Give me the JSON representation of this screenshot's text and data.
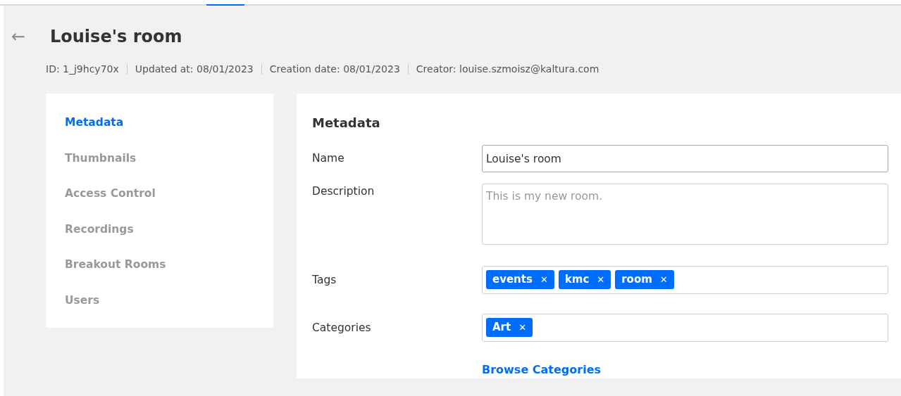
{
  "back_icon": "←",
  "title": "Louise's room",
  "meta": [
    "ID: 1_j9hcy70x",
    "Updated at: 08/01/2023",
    "Creation date: 08/01/2023",
    "Creator: louise.szmoisz@kaltura.com"
  ],
  "sidebar": {
    "items": [
      {
        "label": "Metadata",
        "selected": true
      },
      {
        "label": "Thumbnails",
        "selected": false
      },
      {
        "label": "Access Control",
        "selected": false
      },
      {
        "label": "Recordings",
        "selected": false
      },
      {
        "label": "Breakout Rooms",
        "selected": false
      },
      {
        "label": "Users",
        "selected": false
      }
    ]
  },
  "form": {
    "heading": "Metadata",
    "fields": [
      {
        "kind": "input",
        "label": "Name",
        "value": "Louise's room"
      },
      {
        "kind": "textarea",
        "label": "Description",
        "placeholder": "This is my new room."
      },
      {
        "kind": "chips",
        "label": "Tags",
        "chips": [
          {
            "label": "events",
            "remove": "✕"
          },
          {
            "label": "kmc",
            "remove": "✕"
          },
          {
            "label": "room",
            "remove": "✕"
          }
        ]
      },
      {
        "kind": "chips",
        "label": "Categories",
        "chips": [
          {
            "label": "Art",
            "remove": "✕"
          }
        ]
      }
    ],
    "link": "Browse Categories"
  }
}
